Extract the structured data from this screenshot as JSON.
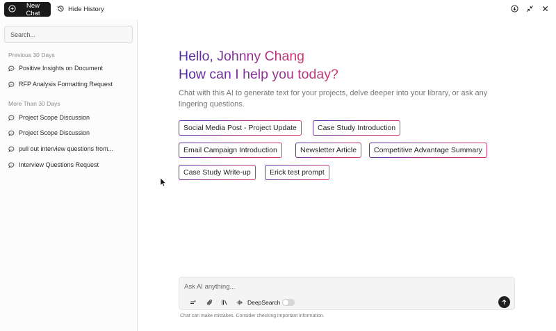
{
  "topbar": {
    "new_chat_label": "New Chat",
    "hide_history_label": "Hide History",
    "icons": [
      "download-circle-icon",
      "collapse-icon",
      "close-icon"
    ]
  },
  "sidebar": {
    "search_placeholder": "Search...",
    "sections": [
      {
        "label": "Previous 30 Days",
        "items": [
          "Positive Insights on Document",
          "RFP Analysis Formatting Request"
        ]
      },
      {
        "label": "More Than 30 Days",
        "items": [
          "Project Scope Discussion",
          "Project Scope Discussion",
          "pull out interview questions from...",
          "Interview Questions Request"
        ]
      }
    ]
  },
  "main": {
    "greeting_line1": "Hello, Johnny Chang",
    "greeting_line2": "How can I help you today?",
    "subtitle": "Chat with this AI to generate text for your projects, delve deeper into your library, or ask any lingering questions.",
    "prompts": [
      "Social Media Post - Project Update",
      "Case Study Introduction",
      "Email Campaign Introduction",
      "Newsletter Article",
      "Competitive Advantage Summary",
      "Case Study Write-up",
      "Erick test prompt"
    ]
  },
  "composer": {
    "placeholder": "Ask AI anything...",
    "deepsearch_label": "DeepSearch",
    "deepsearch_enabled": false,
    "disclaimer": "Chat can make mistakes. Consider checking important information."
  },
  "colors": {
    "gradient_start": "#4b2a9e",
    "gradient_end": "#d2376a",
    "dark_button": "#1a1a1a"
  }
}
